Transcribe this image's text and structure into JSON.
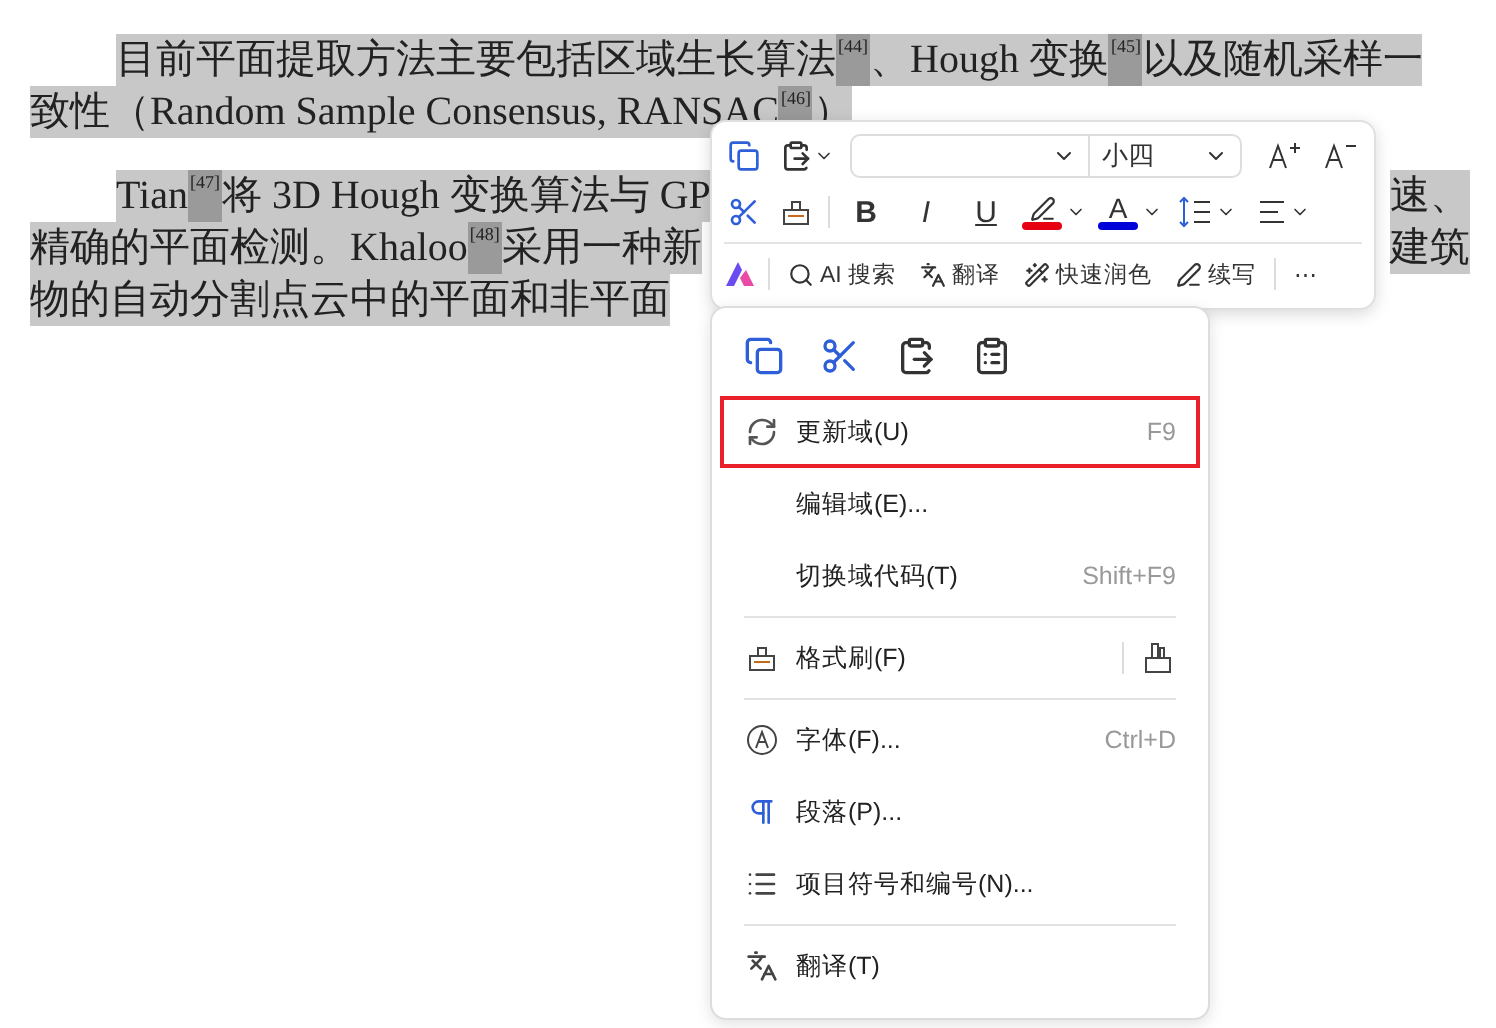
{
  "document": {
    "lines": [
      {
        "indented": true,
        "left": [
          {
            "kind": "text",
            "text": "目前平面提取方法主要包括区域生长算法"
          },
          {
            "kind": "cite",
            "text": "[44]"
          },
          {
            "kind": "text",
            "text": "、Hough 变换"
          },
          {
            "kind": "cite",
            "text": "[45]"
          },
          {
            "kind": "text",
            "text": "以及随机采样一"
          }
        ]
      },
      {
        "indented": false,
        "left": [
          {
            "kind": "text",
            "text": "致性（Random Sample Consensus, RANSAC"
          },
          {
            "kind": "cite",
            "text": "[46]"
          },
          {
            "kind": "text",
            "text": "）"
          }
        ]
      },
      {
        "indented": true,
        "left": [
          {
            "kind": "text",
            "text": "Tian"
          },
          {
            "kind": "cite",
            "text": "[47]"
          },
          {
            "kind": "text",
            "text": "将 3D Hough 变换算法与 GP"
          }
        ],
        "right": [
          {
            "kind": "text",
            "text": "速、"
          }
        ]
      },
      {
        "indented": false,
        "left": [
          {
            "kind": "text",
            "text": "精确的平面检测。Khaloo"
          },
          {
            "kind": "cite",
            "text": "[48]"
          },
          {
            "kind": "text",
            "text": "采用一种新"
          }
        ],
        "right": [
          {
            "kind": "text",
            "text": "建筑"
          }
        ]
      },
      {
        "indented": false,
        "left": [
          {
            "kind": "text",
            "text": "物的自动分割点云中的平面和非平面"
          }
        ]
      }
    ]
  },
  "toolbar": {
    "font_size": {
      "value": "小四"
    },
    "format_buttons": [
      {
        "kind": "bold",
        "text": "B"
      },
      {
        "kind": "italic",
        "text": "I"
      },
      {
        "kind": "underline",
        "text": "U"
      }
    ],
    "color_buttons": [
      {
        "kind": "highlight",
        "color": "#e60012"
      },
      {
        "kind": "font",
        "text": "A",
        "color": "#0000d8"
      }
    ],
    "ai_actions": [
      {
        "kind": "search",
        "label": "AI 搜索"
      },
      {
        "kind": "translate",
        "label": "翻译"
      },
      {
        "kind": "polish",
        "label": "快速润色"
      },
      {
        "kind": "continue",
        "label": "续写"
      }
    ],
    "more": "⋯"
  },
  "context_menu": {
    "items": [
      {
        "kind": "item",
        "label": "更新域(U)",
        "shortcut": "F9",
        "selected": true
      },
      {
        "kind": "item",
        "label": "编辑域(E)...",
        "selected": false
      },
      {
        "kind": "item",
        "label": "切换域代码(T)",
        "shortcut": "Shift+F9",
        "selected": false
      },
      {
        "kind": "divider"
      },
      {
        "kind": "split",
        "label": "格式刷(F)",
        "selected": false
      },
      {
        "kind": "divider"
      },
      {
        "kind": "item",
        "label": "字体(F)...",
        "shortcut": "Ctrl+D",
        "selected": false
      },
      {
        "kind": "item",
        "label": "段落(P)...",
        "selected": false
      },
      {
        "kind": "item",
        "label": "项目符号和编号(N)...",
        "selected": false
      },
      {
        "kind": "divider"
      },
      {
        "kind": "item",
        "label": "翻译(T)",
        "selected": false
      }
    ]
  }
}
